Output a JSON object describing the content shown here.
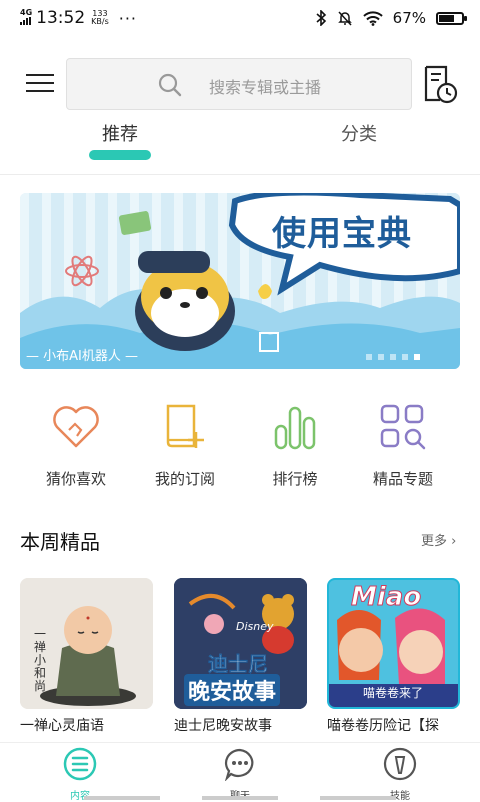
{
  "status_bar": {
    "network": "4G",
    "time": "13:52",
    "speed_value": "133",
    "speed_unit": "KB/s",
    "more": "···",
    "battery": "67%",
    "battery_level": 0.67
  },
  "search": {
    "placeholder": "搜索专辑或主播"
  },
  "tabs": [
    {
      "label": "推荐",
      "active": true
    },
    {
      "label": "分类",
      "active": false
    }
  ],
  "banner": {
    "title": "使用宝典",
    "caption": "— 小布AI机器人 —",
    "dot_count": 5,
    "active_dot": 4
  },
  "quick_links": [
    {
      "label": "猜你喜欢",
      "icon": "heart-hand-icon"
    },
    {
      "label": "我的订阅",
      "icon": "book-plus-icon"
    },
    {
      "label": "排行榜",
      "icon": "bar-chart-icon"
    },
    {
      "label": "精品专题",
      "icon": "grid-search-icon"
    }
  ],
  "section": {
    "title": "本周精品",
    "more": "更多 ›"
  },
  "cards": [
    {
      "title": "一禅心灵庙语",
      "cover_text": "一禅小和尚"
    },
    {
      "title": "迪士尼晚安故事",
      "cover_text_1": "迪士尼",
      "cover_text_2": "晚安故事",
      "cover_brand": "Disney"
    },
    {
      "title": "喵卷卷历险记【探",
      "cover_text_1": "Miao",
      "cover_text_2": "喵卷卷来了"
    }
  ],
  "bottom_nav": [
    {
      "label": "内容",
      "active": true
    },
    {
      "label": "聊天",
      "active": false
    },
    {
      "label": "技能",
      "active": false
    }
  ],
  "colors": {
    "accent": "#2bc8b4",
    "banner_title": "#1f5d9a",
    "icon_orange": "#e8875a",
    "icon_yellow": "#e9b43a",
    "icon_green": "#7cc36b",
    "icon_purple": "#8a7cc6"
  }
}
